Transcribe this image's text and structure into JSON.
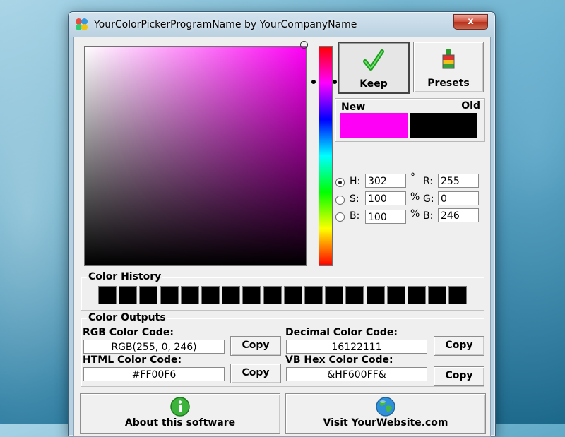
{
  "window": {
    "title": "YourColorPickerProgramName by YourCompanyName",
    "close_label": "x"
  },
  "picker": {
    "keep_label": "Keep",
    "presets_label": "Presets",
    "new_label": "New",
    "old_label": "Old",
    "new_color": "#ff00f6",
    "old_color": "#000000",
    "base_hue_color": "#ff00f6"
  },
  "fields": {
    "h_label": "H:",
    "h_value": "302",
    "h_unit": "°",
    "s_label": "S:",
    "s_value": "100",
    "s_unit": "%",
    "b_label": "B:",
    "b_value": "100",
    "b_unit": "%",
    "r_label": "R:",
    "r_value": "255",
    "g_label": "G:",
    "g_value": "0",
    "bl_label": "B:",
    "bl_value": "246",
    "selected_mode": "H"
  },
  "history": {
    "title": "Color History",
    "colors": [
      "#000000",
      "#000000",
      "#000000",
      "#000000",
      "#000000",
      "#000000",
      "#000000",
      "#000000",
      "#000000",
      "#000000",
      "#000000",
      "#000000",
      "#000000",
      "#000000",
      "#000000",
      "#000000",
      "#000000",
      "#000000"
    ]
  },
  "outputs": {
    "title": "Color Outputs",
    "rgb_label": "RGB Color Code:",
    "rgb_value": "RGB(255, 0, 246)",
    "decimal_label": "Decimal Color Code:",
    "decimal_value": "16122111",
    "html_label": "HTML Color Code:",
    "html_value": "#FF00F6",
    "vb_label": "VB Hex Color Code:",
    "vb_value": "&HF600FF&",
    "copy_label": "Copy"
  },
  "footer": {
    "about_label": "About this software",
    "visit_label": "Visit YourWebsite.com"
  },
  "icons": {
    "keep": "checkmark-icon",
    "presets": "paint-brush-icon",
    "about": "info-icon",
    "visit": "globe-icon"
  }
}
